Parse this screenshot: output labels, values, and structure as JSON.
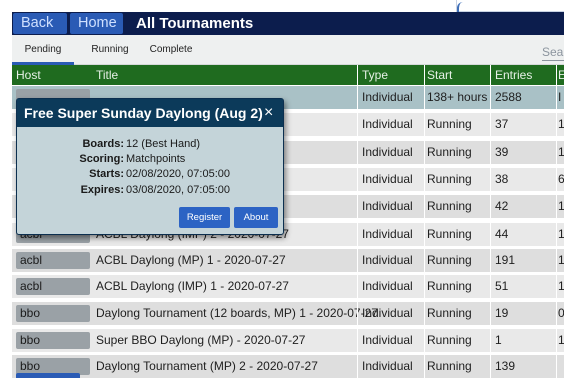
{
  "topbar": {
    "back_label": "Back",
    "home_label": "Home",
    "title": "All Tournaments"
  },
  "tabs": [
    {
      "label": "Pending",
      "selected": true
    },
    {
      "label": "Running",
      "selected": false
    },
    {
      "label": "Complete",
      "selected": false
    }
  ],
  "search": {
    "placeholder": "Sea"
  },
  "table": {
    "headers": [
      "Host",
      "Title",
      "Type",
      "Start",
      "Entries",
      "E"
    ],
    "rows": [
      {
        "host": "",
        "title": "",
        "type": "Individual",
        "start": "138+ hours",
        "entries": "2588",
        "extra": "I"
      },
      {
        "host": "",
        "title": "20-07-27",
        "type": "Individual",
        "start": "Running",
        "entries": "37",
        "extra": "1"
      },
      {
        "host": "",
        "title": "",
        "type": "Individual",
        "start": "Running",
        "entries": "39",
        "extra": "1"
      },
      {
        "host": "",
        "title": "- 2020-07-27",
        "type": "Individual",
        "start": "Running",
        "entries": "38",
        "extra": "6"
      },
      {
        "host": "",
        "title": "",
        "type": "Individual",
        "start": "Running",
        "entries": "42",
        "extra": "1"
      },
      {
        "host": "acbl",
        "title": "ACBL Daylong (IMP) 2 - 2020-07-27",
        "type": "Individual",
        "start": "Running",
        "entries": "44",
        "extra": "1"
      },
      {
        "host": "acbl",
        "title": "ACBL Daylong (MP) 1 - 2020-07-27",
        "type": "Individual",
        "start": "Running",
        "entries": "191",
        "extra": "1"
      },
      {
        "host": "acbl",
        "title": "ACBL Daylong (IMP) 1 - 2020-07-27",
        "type": "Individual",
        "start": "Running",
        "entries": "51",
        "extra": "1"
      },
      {
        "host": "bbo",
        "title": "Daylong Tournament (12 boards, MP) 1 - 2020-07-27",
        "type": "Individual",
        "start": "Running",
        "entries": "19",
        "extra": "0"
      },
      {
        "host": "bbo",
        "title": "Super BBO Daylong (MP) - 2020-07-27",
        "type": "Individual",
        "start": "Running",
        "entries": "1",
        "extra": "1"
      },
      {
        "host": "bbo",
        "title": "Daylong Tournament (MP) 2 - 2020-07-27",
        "type": "Individual",
        "start": "Running",
        "entries": "139",
        "extra": ""
      }
    ]
  },
  "modal": {
    "title": "Free Super Sunday Daylong (Aug 2)",
    "close_glyph": "×",
    "fields": [
      {
        "key": "Boards:",
        "value": "12 (Best Hand)"
      },
      {
        "key": "Scoring:",
        "value": "Matchpoints"
      },
      {
        "key": "Starts:",
        "value": "02/08/2020, 07:05:00"
      },
      {
        "key": "Expires:",
        "value": "03/08/2020, 07:05:00"
      }
    ],
    "register_label": "Register",
    "about_label": "About"
  },
  "colors": {
    "topbar_bg": "#0c1d4d",
    "button_blue": "#2a5bb5",
    "header_green": "#1f6b1f",
    "modal_head": "#0c3a5a",
    "modal_body": "#c4d4d9"
  }
}
